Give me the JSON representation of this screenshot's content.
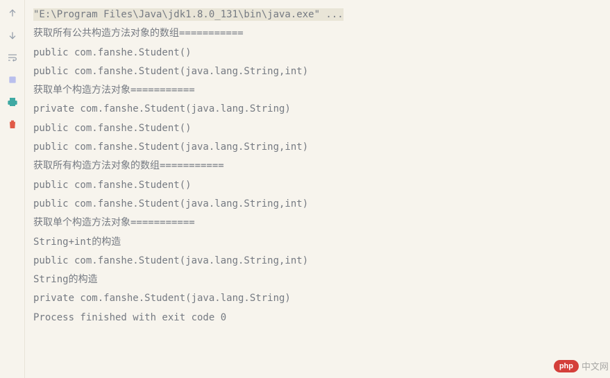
{
  "gutter": {
    "icons": [
      "arrow-up",
      "arrow-down",
      "wrap",
      "box",
      "print",
      "trash"
    ]
  },
  "console": {
    "cmd": "\"E:\\Program Files\\Java\\jdk1.8.0_131\\bin\\java.exe\" ...",
    "lines": [
      "获取所有公共构造方法对象的数组===========",
      "public com.fanshe.Student()",
      "public com.fanshe.Student(java.lang.String,int)",
      "获取单个构造方法对象===========",
      "private com.fanshe.Student(java.lang.String)",
      "public com.fanshe.Student()",
      "public com.fanshe.Student(java.lang.String,int)",
      "获取所有构造方法对象的数组===========",
      "public com.fanshe.Student()",
      "public com.fanshe.Student(java.lang.String,int)",
      "获取单个构造方法对象===========",
      "String+int的构造",
      "public com.fanshe.Student(java.lang.String,int)",
      "String的构造",
      "private com.fanshe.Student(java.lang.String)",
      "",
      "Process finished with exit code 0"
    ]
  },
  "watermark": {
    "pill": "php",
    "text": "中文网"
  }
}
